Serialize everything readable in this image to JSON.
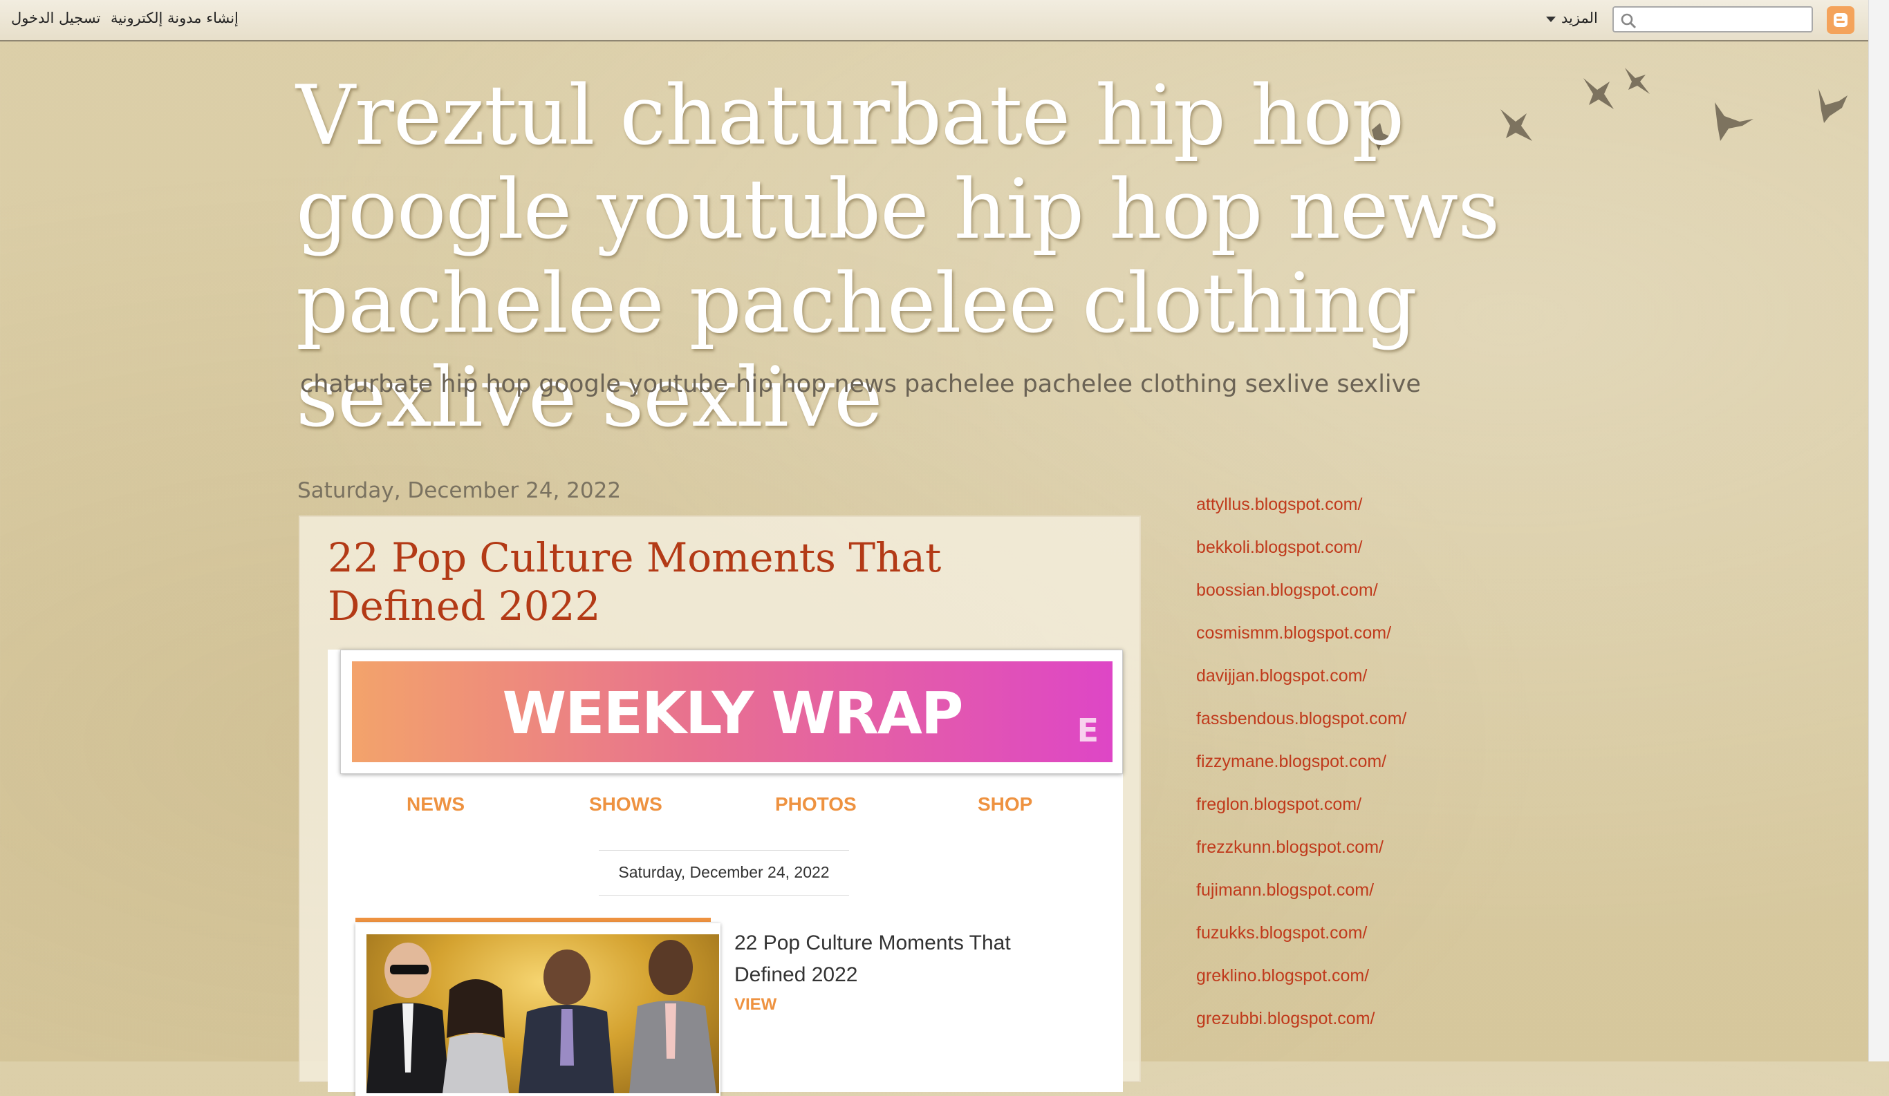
{
  "navbar": {
    "sign_in": "تسجيل الدخول",
    "create_blog": "إنشاء مدونة إلكترونية",
    "more": "المزيد",
    "search_value": "",
    "search_placeholder": "",
    "accent_color": "#f4a35b"
  },
  "header": {
    "title": "Vreztul chaturbate hip hop google youtube hip hop news pachelee pachelee clothing sexlive sexlive",
    "description": "chaturbate hip hop google youtube hip hop news pachelee pachelee clothing sexlive sexlive"
  },
  "main": {
    "date_header": "Saturday, December 24, 2022",
    "post": {
      "title": "22 Pop Culture Moments That Defined 2022",
      "email": {
        "banner_text": "WEEKLY WRAP",
        "banner_logo": "E",
        "nav": [
          "NEWS",
          "SHOWS",
          "PHOTOS",
          "SHOP"
        ],
        "date": "Saturday, December 24, 2022",
        "story": {
          "title": "22 Pop Culture Moments That Defined 2022",
          "cta": "VIEW"
        }
      }
    }
  },
  "sidebar": {
    "links": [
      "attyllus.blogspot.com/",
      "bekkoli.blogspot.com/",
      "boossian.blogspot.com/",
      "cosmismm.blogspot.com/",
      "davijjan.blogspot.com/",
      "fassbendous.blogspot.com/",
      "fizzymane.blogspot.com/",
      "freglon.blogspot.com/",
      "frezzkunn.blogspot.com/",
      "fujimann.blogspot.com/",
      "fuzukks.blogspot.com/",
      "greklino.blogspot.com/",
      "grezubbi.blogspot.com/"
    ],
    "link_color": "#c03a1c"
  }
}
